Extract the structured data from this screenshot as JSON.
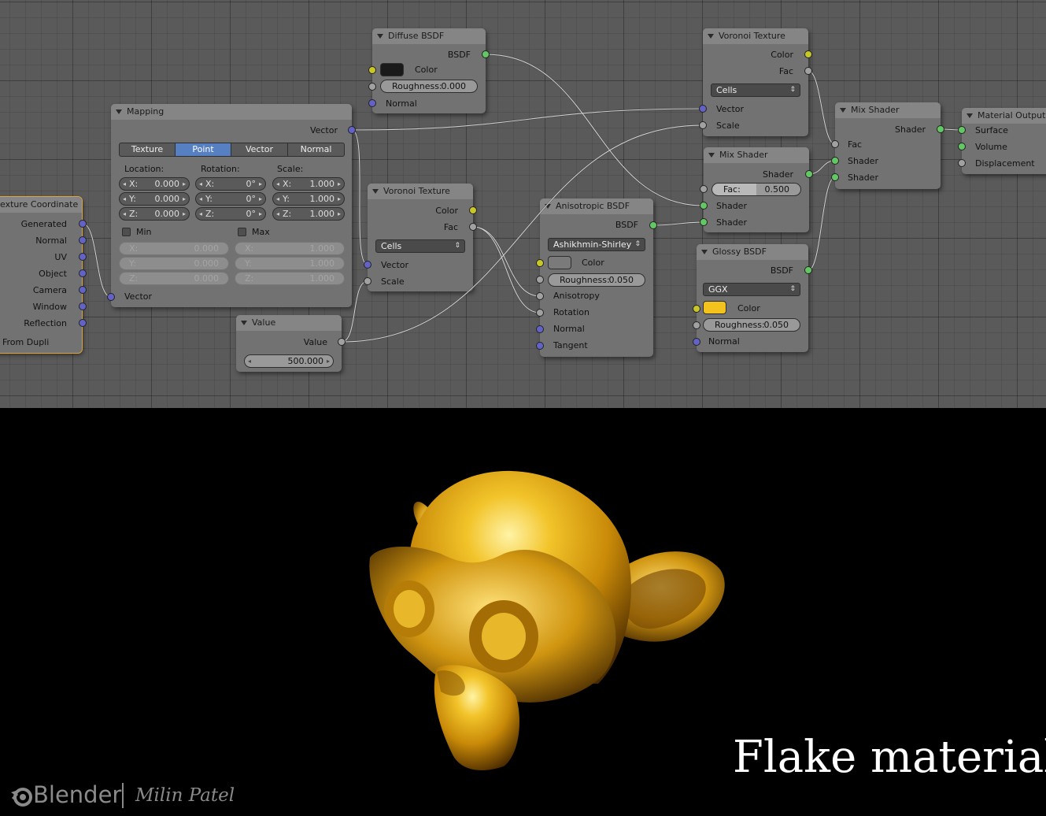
{
  "nodes": {
    "texcoord": {
      "title": "exture Coordinate",
      "outputs": [
        "Generated",
        "Normal",
        "UV",
        "Object",
        "Camera",
        "Window",
        "Reflection"
      ],
      "from_dupli": "From Dupli"
    },
    "mapping": {
      "title": "Mapping",
      "output": "Vector",
      "tabs": [
        "Texture",
        "Point",
        "Vector",
        "Normal"
      ],
      "active_tab": "Point",
      "location_label": "Location:",
      "rotation_label": "Rotation:",
      "scale_label": "Scale:",
      "location": [
        {
          "axis": "X:",
          "value": "0.000"
        },
        {
          "axis": "Y:",
          "value": "0.000"
        },
        {
          "axis": "Z:",
          "value": "0.000"
        }
      ],
      "rotation": [
        {
          "axis": "X:",
          "value": "0°"
        },
        {
          "axis": "Y:",
          "value": "0°"
        },
        {
          "axis": "Z:",
          "value": "0°"
        }
      ],
      "scale": [
        {
          "axis": "X:",
          "value": "1.000"
        },
        {
          "axis": "Y:",
          "value": "1.000"
        },
        {
          "axis": "Z:",
          "value": "1.000"
        }
      ],
      "min_label": "Min",
      "max_label": "Max",
      "min": [
        {
          "axis": "X:",
          "value": "0.000"
        },
        {
          "axis": "Y:",
          "value": "0.000"
        },
        {
          "axis": "Z:",
          "value": "0.000"
        }
      ],
      "max": [
        {
          "axis": "X:",
          "value": "1.000"
        },
        {
          "axis": "Y:",
          "value": "1.000"
        },
        {
          "axis": "Z:",
          "value": "1.000"
        }
      ],
      "input": "Vector"
    },
    "value": {
      "title": "Value",
      "output": "Value",
      "field": "500.000"
    },
    "voronoi1": {
      "title": "Voronoi Texture",
      "out_color": "Color",
      "out_fac": "Fac",
      "dropdown": "Cells",
      "in_vector": "Vector",
      "in_scale": "Scale"
    },
    "diffuse": {
      "title": "Diffuse BSDF",
      "output": "BSDF",
      "color_label": "Color",
      "color": "#1a1a1a",
      "roughness_label": "Roughness:",
      "roughness": "0.000",
      "normal_label": "Normal"
    },
    "aniso": {
      "title": "Anisotropic BSDF",
      "output": "BSDF",
      "dropdown": "Ashikhmin-Shirley",
      "color_label": "Color",
      "color": "#7a7a7a",
      "roughness_label": "Roughness:",
      "roughness": "0.050",
      "anisotropy": "Anisotropy",
      "rotation": "Rotation",
      "normal": "Normal",
      "tangent": "Tangent"
    },
    "voronoi2": {
      "title": "Voronoi Texture",
      "out_color": "Color",
      "out_fac": "Fac",
      "dropdown": "Cells",
      "in_vector": "Vector",
      "in_scale": "Scale"
    },
    "mix1": {
      "title": "Mix Shader",
      "output": "Shader",
      "fac_label": "Fac:",
      "fac": "0.500",
      "in1": "Shader",
      "in2": "Shader"
    },
    "glossy": {
      "title": "Glossy BSDF",
      "output": "BSDF",
      "dropdown": "GGX",
      "color_label": "Color",
      "color": "#f4c21c",
      "roughness_label": "Roughness:",
      "roughness": "0.050",
      "normal_label": "Normal"
    },
    "mix2": {
      "title": "Mix Shader",
      "output": "Shader",
      "fac": "Fac",
      "in1": "Shader",
      "in2": "Shader"
    },
    "output": {
      "title": "Material Output",
      "surface": "Surface",
      "volume": "Volume",
      "displacement": "Displacement"
    }
  },
  "render": {
    "caption": "Flake material",
    "brand": "Blender",
    "author": "Milin Patel"
  },
  "colors": {
    "socket_color": "#c7c729",
    "socket_float": "#a1a1a1",
    "socket_vector": "#6363c7",
    "socket_shader": "#63c763",
    "active_tab": "#5680c2"
  }
}
